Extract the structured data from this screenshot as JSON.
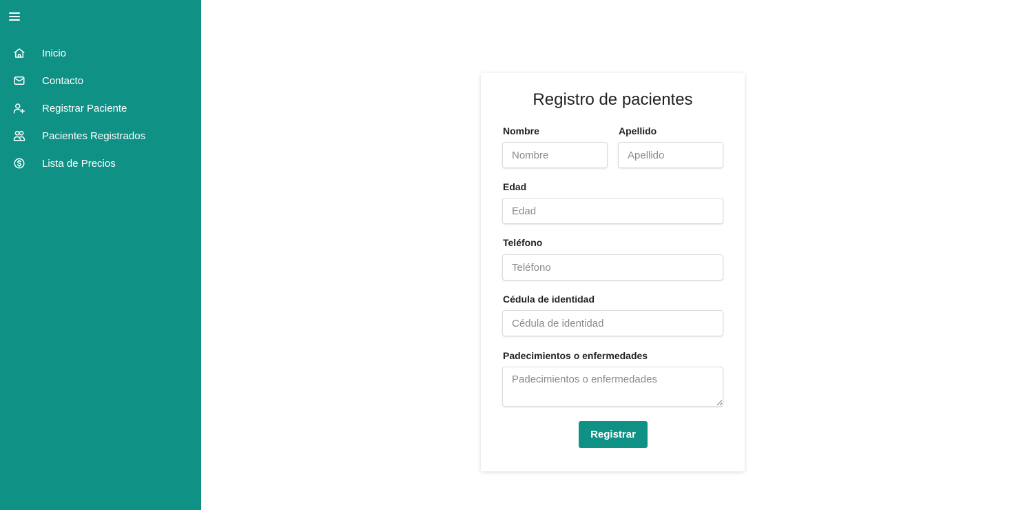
{
  "sidebar": {
    "menu_icon": "hamburger-menu-icon",
    "background_color": "#0f9185",
    "items": [
      {
        "label": "Inicio",
        "icon": "home-icon"
      },
      {
        "label": "Contacto",
        "icon": "mail-icon"
      },
      {
        "label": "Registrar Paciente",
        "icon": "user-plus-icon"
      },
      {
        "label": "Pacientes Registrados",
        "icon": "users-icon"
      },
      {
        "label": "Lista de Precios",
        "icon": "dollar-circle-icon"
      }
    ]
  },
  "form": {
    "title": "Registro de pacientes",
    "fields": {
      "nombre": {
        "label": "Nombre",
        "placeholder": "Nombre",
        "value": ""
      },
      "apellido": {
        "label": "Apellido",
        "placeholder": "Apellido",
        "value": ""
      },
      "edad": {
        "label": "Edad",
        "placeholder": "Edad",
        "value": ""
      },
      "telefono": {
        "label": "Teléfono",
        "placeholder": "Teléfono",
        "value": ""
      },
      "cedula": {
        "label": "Cédula de identidad",
        "placeholder": "Cédula de identidad",
        "value": ""
      },
      "padecimientos": {
        "label": "Padecimientos o enfermedades",
        "placeholder": "Padecimientos o enfermedades",
        "value": ""
      }
    },
    "submit_label": "Registrar",
    "accent_color": "#0f9185"
  }
}
